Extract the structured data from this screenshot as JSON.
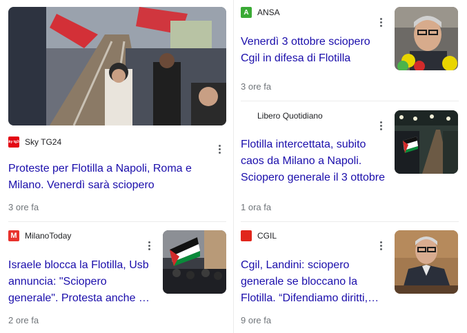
{
  "cards": [
    {
      "source": "Sky TG24",
      "favicon_label": "sky tg24",
      "favicon_color": "#e30613",
      "headline": "Proteste per Flotilla a Napoli, Roma e Milano. Venerdì sarà sciopero",
      "time": "3 ore fa",
      "icon": "sky-tg24-favicon"
    },
    {
      "source": "ANSA",
      "favicon_label": "A",
      "favicon_color": "#3aaa35",
      "headline": "Venerdì 3 ottobre sciopero Cgil in difesa di Flotilla",
      "time": "3 ore fa",
      "icon": "ansa-favicon"
    },
    {
      "source": "Libero Quotidiano",
      "favicon_label": "",
      "favicon_color": "#ffffff",
      "headline": "Flotilla intercettata, subito caos da Milano a Napoli. Sciopero generale il 3 ottobre",
      "time": "1 ora fa",
      "icon": "libero-favicon"
    },
    {
      "source": "MilanoToday",
      "favicon_label": "M",
      "favicon_color": "#e8322d",
      "headline": "Israele blocca la Flotilla, Usb annuncia: \"Sciopero generale\". Protesta anche a Milano",
      "time": "2 ore fa",
      "icon": "milanotoday-favicon"
    },
    {
      "source": "CGIL",
      "favicon_label": "",
      "favicon_color": "#e1261c",
      "headline": "Cgil, Landini: sciopero generale se bloccano la Flotilla. “Difendiamo diritti, Costituzione”",
      "time": "9 ore fa",
      "icon": "cgil-favicon"
    }
  ],
  "colors": {
    "headline": "#1a0dab",
    "meta": "#70757a",
    "separator": "#ebebeb"
  }
}
